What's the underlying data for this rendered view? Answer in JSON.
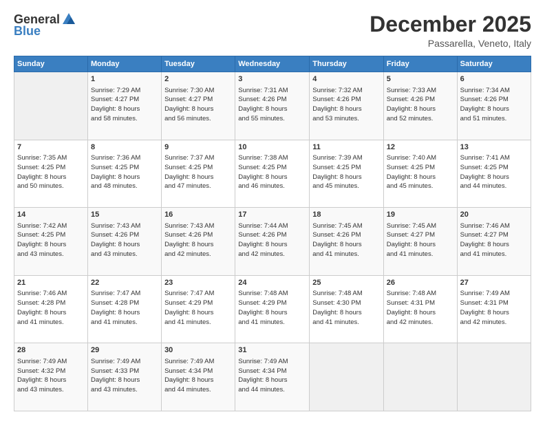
{
  "header": {
    "logo": {
      "general": "General",
      "blue": "Blue"
    },
    "title": "December 2025",
    "location": "Passarella, Veneto, Italy"
  },
  "calendar": {
    "days_of_week": [
      "Sunday",
      "Monday",
      "Tuesday",
      "Wednesday",
      "Thursday",
      "Friday",
      "Saturday"
    ],
    "weeks": [
      [
        {
          "day": "",
          "info": ""
        },
        {
          "day": "1",
          "info": "Sunrise: 7:29 AM\nSunset: 4:27 PM\nDaylight: 8 hours\nand 58 minutes."
        },
        {
          "day": "2",
          "info": "Sunrise: 7:30 AM\nSunset: 4:27 PM\nDaylight: 8 hours\nand 56 minutes."
        },
        {
          "day": "3",
          "info": "Sunrise: 7:31 AM\nSunset: 4:26 PM\nDaylight: 8 hours\nand 55 minutes."
        },
        {
          "day": "4",
          "info": "Sunrise: 7:32 AM\nSunset: 4:26 PM\nDaylight: 8 hours\nand 53 minutes."
        },
        {
          "day": "5",
          "info": "Sunrise: 7:33 AM\nSunset: 4:26 PM\nDaylight: 8 hours\nand 52 minutes."
        },
        {
          "day": "6",
          "info": "Sunrise: 7:34 AM\nSunset: 4:26 PM\nDaylight: 8 hours\nand 51 minutes."
        }
      ],
      [
        {
          "day": "7",
          "info": "Sunrise: 7:35 AM\nSunset: 4:25 PM\nDaylight: 8 hours\nand 50 minutes."
        },
        {
          "day": "8",
          "info": "Sunrise: 7:36 AM\nSunset: 4:25 PM\nDaylight: 8 hours\nand 48 minutes."
        },
        {
          "day": "9",
          "info": "Sunrise: 7:37 AM\nSunset: 4:25 PM\nDaylight: 8 hours\nand 47 minutes."
        },
        {
          "day": "10",
          "info": "Sunrise: 7:38 AM\nSunset: 4:25 PM\nDaylight: 8 hours\nand 46 minutes."
        },
        {
          "day": "11",
          "info": "Sunrise: 7:39 AM\nSunset: 4:25 PM\nDaylight: 8 hours\nand 45 minutes."
        },
        {
          "day": "12",
          "info": "Sunrise: 7:40 AM\nSunset: 4:25 PM\nDaylight: 8 hours\nand 45 minutes."
        },
        {
          "day": "13",
          "info": "Sunrise: 7:41 AM\nSunset: 4:25 PM\nDaylight: 8 hours\nand 44 minutes."
        }
      ],
      [
        {
          "day": "14",
          "info": "Sunrise: 7:42 AM\nSunset: 4:25 PM\nDaylight: 8 hours\nand 43 minutes."
        },
        {
          "day": "15",
          "info": "Sunrise: 7:43 AM\nSunset: 4:26 PM\nDaylight: 8 hours\nand 43 minutes."
        },
        {
          "day": "16",
          "info": "Sunrise: 7:43 AM\nSunset: 4:26 PM\nDaylight: 8 hours\nand 42 minutes."
        },
        {
          "day": "17",
          "info": "Sunrise: 7:44 AM\nSunset: 4:26 PM\nDaylight: 8 hours\nand 42 minutes."
        },
        {
          "day": "18",
          "info": "Sunrise: 7:45 AM\nSunset: 4:26 PM\nDaylight: 8 hours\nand 41 minutes."
        },
        {
          "day": "19",
          "info": "Sunrise: 7:45 AM\nSunset: 4:27 PM\nDaylight: 8 hours\nand 41 minutes."
        },
        {
          "day": "20",
          "info": "Sunrise: 7:46 AM\nSunset: 4:27 PM\nDaylight: 8 hours\nand 41 minutes."
        }
      ],
      [
        {
          "day": "21",
          "info": "Sunrise: 7:46 AM\nSunset: 4:28 PM\nDaylight: 8 hours\nand 41 minutes."
        },
        {
          "day": "22",
          "info": "Sunrise: 7:47 AM\nSunset: 4:28 PM\nDaylight: 8 hours\nand 41 minutes."
        },
        {
          "day": "23",
          "info": "Sunrise: 7:47 AM\nSunset: 4:29 PM\nDaylight: 8 hours\nand 41 minutes."
        },
        {
          "day": "24",
          "info": "Sunrise: 7:48 AM\nSunset: 4:29 PM\nDaylight: 8 hours\nand 41 minutes."
        },
        {
          "day": "25",
          "info": "Sunrise: 7:48 AM\nSunset: 4:30 PM\nDaylight: 8 hours\nand 41 minutes."
        },
        {
          "day": "26",
          "info": "Sunrise: 7:48 AM\nSunset: 4:31 PM\nDaylight: 8 hours\nand 42 minutes."
        },
        {
          "day": "27",
          "info": "Sunrise: 7:49 AM\nSunset: 4:31 PM\nDaylight: 8 hours\nand 42 minutes."
        }
      ],
      [
        {
          "day": "28",
          "info": "Sunrise: 7:49 AM\nSunset: 4:32 PM\nDaylight: 8 hours\nand 43 minutes."
        },
        {
          "day": "29",
          "info": "Sunrise: 7:49 AM\nSunset: 4:33 PM\nDaylight: 8 hours\nand 43 minutes."
        },
        {
          "day": "30",
          "info": "Sunrise: 7:49 AM\nSunset: 4:34 PM\nDaylight: 8 hours\nand 44 minutes."
        },
        {
          "day": "31",
          "info": "Sunrise: 7:49 AM\nSunset: 4:34 PM\nDaylight: 8 hours\nand 44 minutes."
        },
        {
          "day": "",
          "info": ""
        },
        {
          "day": "",
          "info": ""
        },
        {
          "day": "",
          "info": ""
        }
      ]
    ]
  }
}
